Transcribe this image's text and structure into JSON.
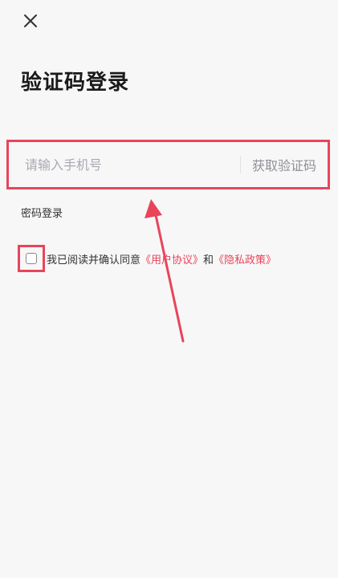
{
  "page": {
    "title": "验证码登录"
  },
  "form": {
    "phone_placeholder": "请输入手机号",
    "get_code_label": "获取验证码",
    "password_login_label": "密码登录"
  },
  "agreement": {
    "prefix": "我已阅读并确认同意",
    "user_agreement": "《用户协议》",
    "conjunction": "和",
    "privacy_policy": "《隐私政策》"
  },
  "colors": {
    "highlight": "#e8455a",
    "link": "#e8455a",
    "background": "#f7f7f8"
  },
  "icons": {
    "close": "close-icon",
    "checkbox": "checkbox-icon"
  }
}
